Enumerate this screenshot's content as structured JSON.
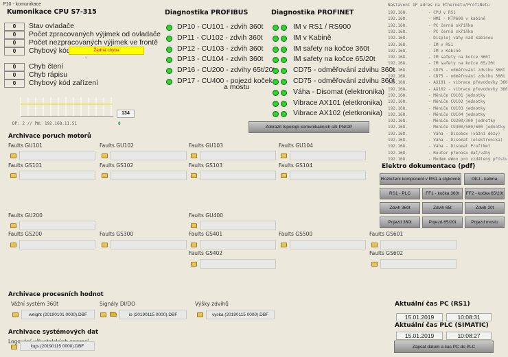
{
  "window_title": "P10 - komunikace",
  "cpu": {
    "title": "Kumonikace CPU S7-315",
    "rows": [
      {
        "value": "0",
        "label": "Stav ovladače"
      },
      {
        "value": "0",
        "label": "Počet zpracovaných výjimek od ovladače"
      },
      {
        "value": "0",
        "label": "Počet nezpracovaných výjimek ve frontě"
      },
      {
        "value": "0",
        "label": "Chybový kód"
      }
    ],
    "error_text": "Žádná chyba",
    "dash": "-",
    "rows2": [
      {
        "value": "0",
        "label": "Chyb čtení"
      },
      {
        "value": "0",
        "label": "Chyb rápisu"
      },
      {
        "value": "0",
        "label": "Chybový kód zařízení"
      }
    ],
    "trend_value": "134",
    "address": "DP: 2  //  PN: 192.168.11.51",
    "status_value": "0"
  },
  "profibus": {
    "title": "Diagnostika PROFIBUS",
    "items": [
      "DP10 - CU101 - zdvih 360t",
      "DP11 - CU102 - zdvih 360t",
      "DP12 - CU103 - zdvih 360t",
      "DP13 - CU104 - zdvih 360t",
      "DP16 - CU200 - zdvihy 65t/20t",
      "DP17 - CU400 - pojezd koček"
    ],
    "item_cont": "a mostu",
    "led_color": "#2fd12f"
  },
  "profinet": {
    "title": "Diagnostika PROFINET",
    "items": [
      "IM v RS1 / RS900",
      "IM v Kabině",
      "IM safety na kočce 360t",
      "IM safety na kočce 65/20t",
      "CD75 - odměřování zdvihu 360t",
      "CD75 - odměřování zdvihu 360t",
      "Váha - Disomat (elektronika)",
      "Vibrace AX101 (eletkronika)",
      "Vibrace AX102 (eletkronika)"
    ],
    "topology_button": "Zobrazit topologii komunikačních sítí PN/DP"
  },
  "ip_list": {
    "title": "Nastavení IP adres na Ethernetu/ProfiNetu",
    "prefix": "192.168.",
    "items": [
      "- CPU v RS1",
      "- HMI - KTP600 v kabině",
      "- PC černá skříňka",
      "- PC černá skříňka",
      "- Displej váhy nad kabinou",
      "- IM v RS1",
      "- IM v Kabině",
      "- IM safety na kočce 360t",
      "- IM safety na kočce 65/20t",
      "- CD75 - odměřování zdvihu 360t",
      "- CD75 - odměřování zdvihu 360t",
      "- AX101 - vibrace převodovky 360t",
      "- AX102 - vibrace převodovky 360t",
      "- Měniče CU101 jednotky",
      "- Měniče CU102 jednotky",
      "- Měniče CU103 jednotky",
      "- Měniče CU104 jednotky",
      "- Měniče CU200/300 jednotky",
      "- Měniče CU400/500/600 jednotky",
      "- Váha - Disobox (vážní dózy)",
      "- Váha - Disomat (elektronika)",
      "- Váha - Disomat ProfiNet",
      "- Router přenosu dat/váhy",
      "- Modem eWon pro vzdálený přístup"
    ]
  },
  "motor_faults": {
    "title": "Archivace poruch motorů",
    "items": [
      "Faults GU101",
      "Faults GU102",
      "Faults GU103",
      "Faults GU104",
      "Faults GS101",
      "Faults GS102",
      "Faults GS103",
      "Faults GS104",
      "Faults GU200",
      "Faults GU400",
      "Faults GS200",
      "Faults GS300",
      "Faults GS401",
      "Faults GS500",
      "Faults GS601",
      "Faults GS402",
      "Faults GS602"
    ]
  },
  "docs": {
    "title": "Elektro dokumentace (pdf)",
    "buttons": [
      "Rozložení komponent v RS1 a stykovně",
      "OKJ - kabina",
      "RS1 - PLC",
      "FF1 - kočka 360t",
      "FF2 - kočka 65/20t",
      "Zdvih 360t",
      "Zdvih 65t",
      "Zdvih 20t",
      "Pojezd 360t",
      "Pojezd 65/20t",
      "Pojezd mostu"
    ]
  },
  "process": {
    "title": "Archivace procesních hodnot",
    "weight": {
      "label": "Vážní systém 360t",
      "file": "weight (20190101 0000).DBF"
    },
    "io": {
      "label": "Signály DI/DO",
      "file": "io (20190115 0000).DBF"
    },
    "height": {
      "label": "Výšky zdvihů",
      "file": "vyska (20190115 0000).DBF"
    }
  },
  "system": {
    "title": "Archivace systémových dat",
    "label": "Logování uživatelských operací",
    "file": "logs (20190115 0000).DBF"
  },
  "time": {
    "pc_title": "Aktuální čas PC (RS1)",
    "pc_date": "15.01.2019",
    "pc_time": "10:08:31",
    "plc_title": "Aktuální čas PLC (SIMATIC)",
    "plc_date": "15.01.2019",
    "plc_time": "10:08:27",
    "write_button": "Zapsat datum a čas PC do PLC"
  }
}
